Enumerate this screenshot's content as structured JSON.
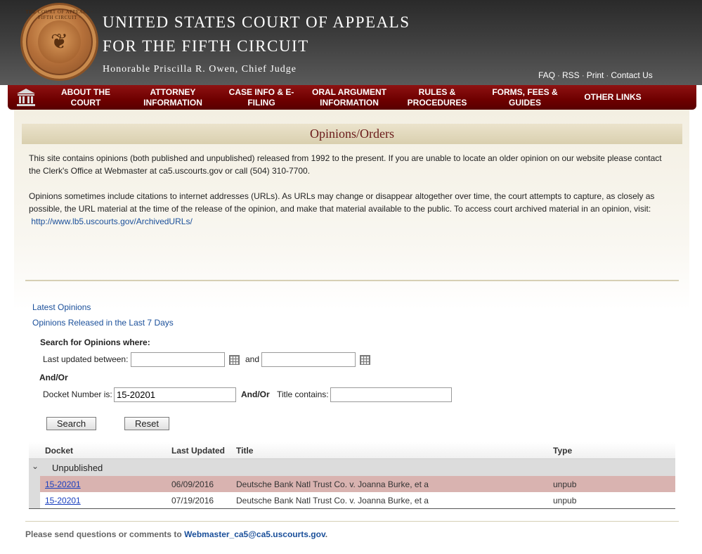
{
  "header": {
    "seal_text": "THE COURT OF APPEALS · FIFTH CIRCUIT ·",
    "title_line1": "UNITED STATES COURT OF APPEALS",
    "title_line2": "FOR THE  FIFTH CIRCUIT",
    "chief_judge": "Honorable Priscilla R. Owen, Chief Judge",
    "top_links": [
      "FAQ",
      "RSS",
      "Print",
      "Contact Us"
    ]
  },
  "nav": {
    "home_icon": "courthouse-icon",
    "items": [
      {
        "line1": "ABOUT THE",
        "line2": "COURT"
      },
      {
        "line1": "ATTORNEY",
        "line2": "INFORMATION"
      },
      {
        "line1": "CASE INFO & E-",
        "line2": "FILING"
      },
      {
        "line1": "ORAL ARGUMENT",
        "line2": "INFORMATION"
      },
      {
        "line1": "RULES &",
        "line2": "PROCEDURES"
      },
      {
        "line1": "FORMS, FEES &",
        "line2": "GUIDES"
      },
      {
        "line1": "OTHER LINKS",
        "line2": ""
      }
    ]
  },
  "main": {
    "section_title": "Opinions/Orders",
    "intro1_line1": "This site contains opinions (both published and unpublished) released from 1992 to the present. If you are unable to locate an older opinion on our website please contact",
    "intro1_line2": "the Clerk's Office at Webmaster at ca5.uscourts.gov or call (504) 310-7700.",
    "intro2_line1": "Opinions sometimes include citations to internet addresses (URLs).  As URLs may change or disappear altogether over time, the court attempts to capture, as closely as",
    "intro2_line2": "possible, the URL material at the time of the release of the opinion, and make that material available to the public. To access court archived material in an opinion, visit:",
    "archived_url": "http://www.lb5.uscourts.gov/ArchivedURLs/",
    "latest_opinions": "Latest Opinions",
    "last_7_days": "Opinions Released in the Last 7 Days"
  },
  "search": {
    "heading": "Search for Opinions where:",
    "last_updated_label": "Last updated between:",
    "date_from": "",
    "and_label": "and",
    "date_to": "",
    "andor1": "And/Or",
    "docket_label": "Docket Number is:",
    "docket_value": "15-20201",
    "andor2": "And/Or",
    "title_label": "Title contains:",
    "title_value": "",
    "search_button": "Search",
    "reset_button": "Reset"
  },
  "results": {
    "columns": [
      "Docket",
      "Last Updated",
      "Title",
      "Type"
    ],
    "group_label": "Unpublished",
    "rows": [
      {
        "docket": "15-20201",
        "updated": "06/09/2016",
        "title": "Deutsche Bank Natl Trust Co. v. Joanna Burke, et a",
        "type": "unpub",
        "highlight": "#d9b3b0"
      },
      {
        "docket": "15-20201",
        "updated": "07/19/2016",
        "title": "Deutsche Bank Natl Trust Co. v. Joanna Burke, et a",
        "type": "unpub",
        "highlight": "#ffffff"
      }
    ]
  },
  "footer": {
    "text": "Please send questions or comments to ",
    "email": "Webmaster_ca5@ca5.uscourts.gov",
    "end": "."
  }
}
